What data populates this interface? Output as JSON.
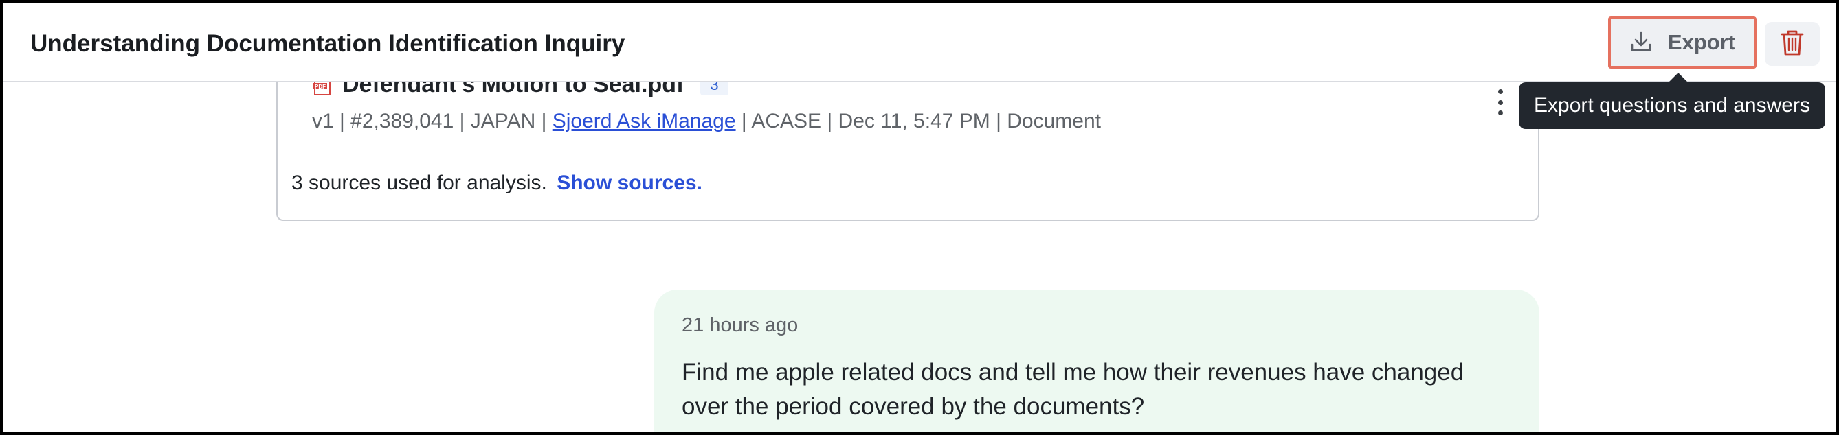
{
  "header": {
    "title": "Understanding Documentation Identification Inquiry",
    "export_label": "Export",
    "tooltip": "Export questions and answers"
  },
  "source_card": {
    "document": {
      "name": "Defendant's Motion to Seal.pdf",
      "badge_count": "3",
      "version": "v1",
      "number": "#2,389,041",
      "location": "JAPAN",
      "author": "Sjoerd Ask iManage",
      "class": "ACASE",
      "date": "Dec 11, 5:47 PM",
      "type": "Document",
      "separator": " | "
    },
    "sources_text": "3 sources used for analysis.",
    "show_sources_label": "Show sources."
  },
  "message": {
    "timestamp": "21 hours ago",
    "text": "Find me apple related docs and tell me how their revenues have changed over the period covered by the documents?"
  },
  "colors": {
    "accent_link": "#2a4fd6",
    "export_highlight": "#e5715f",
    "delete_icon": "#c0392b",
    "message_bg": "#edf9f1",
    "tooltip_bg": "#22272e"
  },
  "icons": {
    "export": "download-icon",
    "delete": "trash-icon",
    "file": "pdf-file-icon",
    "menu": "kebab-menu-icon"
  }
}
